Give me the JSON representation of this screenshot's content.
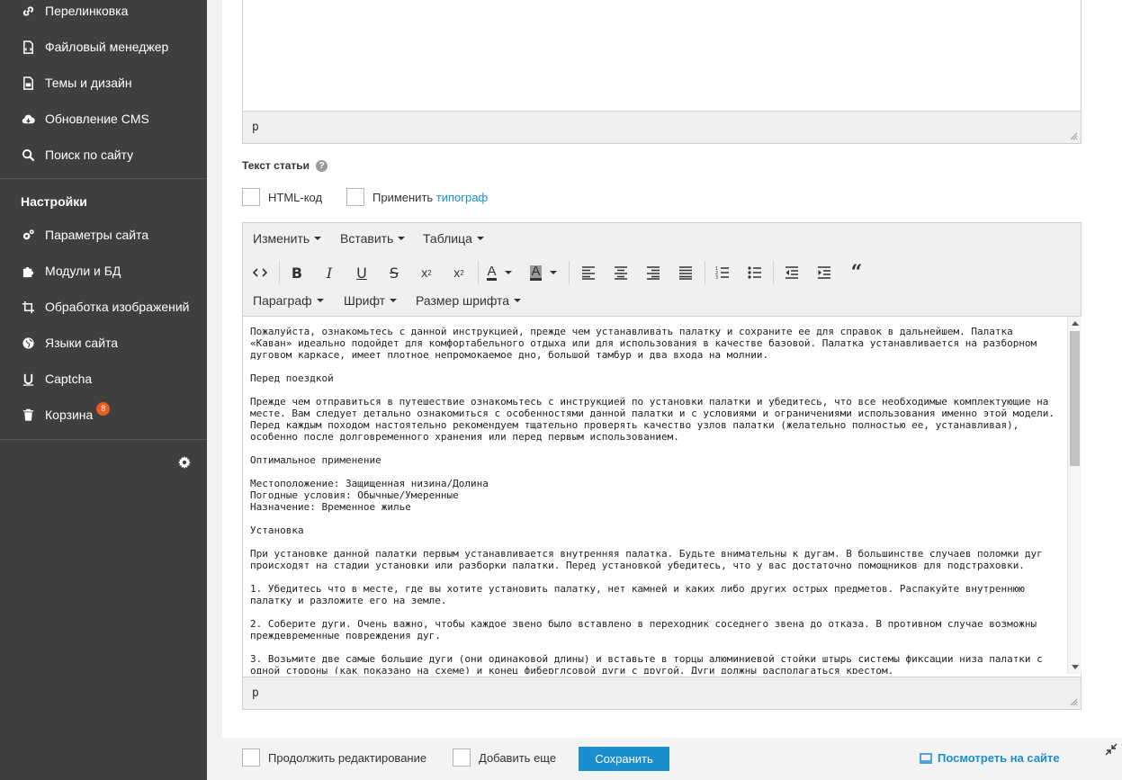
{
  "sidebar": {
    "items": [
      {
        "label": "Перелинковка",
        "icon": "link-icon"
      },
      {
        "label": "Файловый менеджер",
        "icon": "file-icon"
      },
      {
        "label": "Темы и дизайн",
        "icon": "theme-icon"
      },
      {
        "label": "Обновление CMS",
        "icon": "cloud-download-icon"
      },
      {
        "label": "Поиск по сайту",
        "icon": "search-icon"
      }
    ],
    "settings_heading": "Настройки",
    "settings_items": [
      {
        "label": "Параметры сайта",
        "icon": "gears-icon"
      },
      {
        "label": "Модули и БД",
        "icon": "puzzle-icon"
      },
      {
        "label": "Обработка изображений",
        "icon": "crop-icon"
      },
      {
        "label": "Языки сайта",
        "icon": "globe-icon"
      },
      {
        "label": "Captcha",
        "icon": "captcha-icon"
      },
      {
        "label": "Корзина",
        "icon": "trash-icon",
        "badge": "8"
      }
    ]
  },
  "top_editor": {
    "status_path": "p"
  },
  "article": {
    "label": "Текст статьи",
    "html_code_label": "HTML-код",
    "typograph_prefix": "Применить ",
    "typograph_link": "типограф"
  },
  "editor": {
    "menu": {
      "edit": "Изменить",
      "insert": "Вставить",
      "table": "Таблица",
      "paragraph": "Параграф",
      "font": "Шрифт",
      "font_size": "Размер шрифта"
    },
    "status_path": "p",
    "content": [
      "Пожалуйста, ознакомьтесь с данной инструкцией, прежде чем устанавливать палатку и сохраните ее для справок в дальнейшем. Палатка «Каван» идеально подойдет для комфортабельного отдыха или для использования в качестве базовой. Палатка устанавливается на разборном дуговом каркасе, имеет плотное непромокаемое дно, большой тамбур и два входа на молнии.",
      "Перед поездкой",
      "Прежде чем отправиться в путешествие ознакомьтесь с инструкцией по установки палатки и убедитесь, что все необходимые комплектующие на месте. Вам следует детально ознакомиться с особенностями данной палатки и с условиями и ограничениями использования именно этой модели. Перед каждым походом настоятельно рекомендуем тщательно проверять качество узлов палатки (желательно полностью ее, устанавливая), особенно после долговременного хранения или перед первым использованием.",
      "Оптимальное применение",
      "Местоположение: Защищенная низина/Долина\nПогодные условия: Обычные/Умеренные\nНазначение: Временное жилье",
      "Установка",
      "При установке данной палатки первым устанавливается внутренняя палатка. Будьте внимательны к дугам. В большинстве случаев поломки дуг происходят на стадии установки или разборки палатки. Перед установкой убедитесь, что у вас достаточно помощников для подстраховки.",
      "1. Убедитесь что в месте, где вы хотите установить палатку, нет камней и каких либо других острых предметов. Распакуйте внутреннюю палатку и разложите его на земле.",
      "2. Соберите дуги. Очень важно, чтобы каждое звено было вставлено в переходник соседнего звена до отказа. В противном случае возможны преждевременные повреждения дуг.",
      "3. Возьмите две самые большие дуги (они одинаковой длины) и вставьте в торцы алюминиевой стойки штырь системы фиксации низа палатки с одной стороны (как показано на схеме) и конец фиберглсовой дуги с другой. Дуги должны располагаться крестом."
    ]
  },
  "footer": {
    "continue_label": "Продолжить редактирование",
    "add_more_label": "Добавить еще",
    "save_label": "Сохранить",
    "view_label": "Посмотреть на сайте"
  },
  "colors": {
    "sidebar_bg": "#3f3f3f",
    "accent": "#1a8ecf",
    "badge": "#f05a22"
  }
}
